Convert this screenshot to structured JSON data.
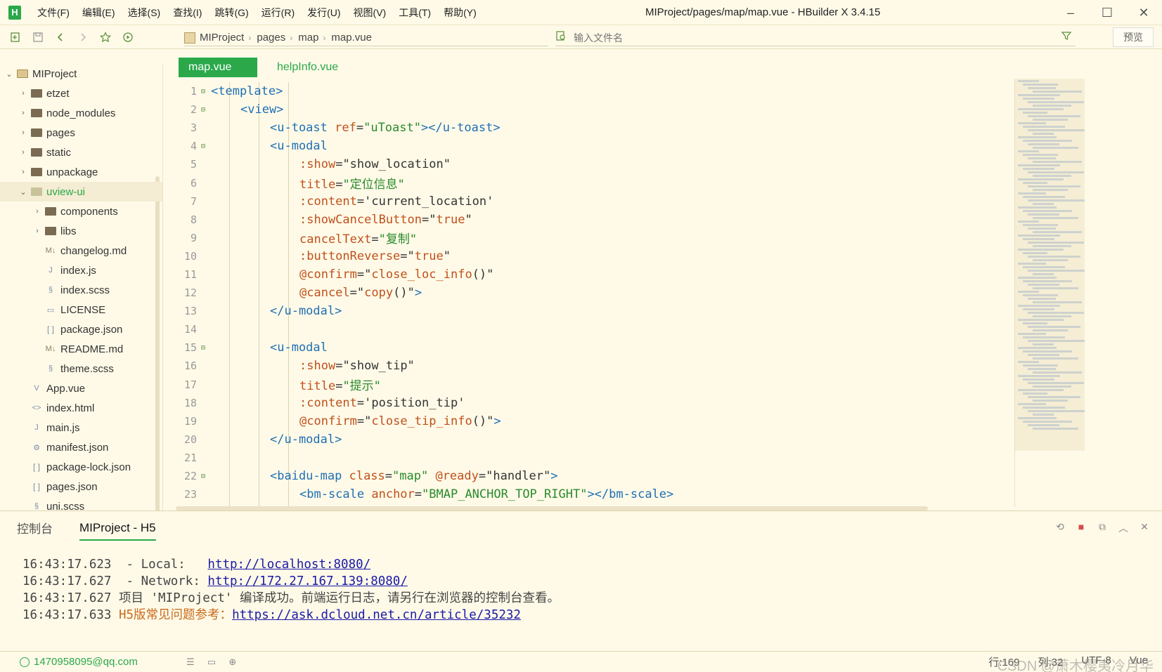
{
  "window": {
    "title": "MIProject/pages/map/map.vue - HBuilder X 3.4.15",
    "logo": "H",
    "controls": [
      "–",
      "☐",
      "✕"
    ]
  },
  "menu": [
    "文件(F)",
    "编辑(E)",
    "选择(S)",
    "查找(I)",
    "跳转(G)",
    "运行(R)",
    "发行(U)",
    "视图(V)",
    "工具(T)",
    "帮助(Y)"
  ],
  "toolbar": {
    "breadcrumb": [
      "MIProject",
      "pages",
      "map",
      "map.vue"
    ],
    "file_search_placeholder": "输入文件名",
    "preview_label": "预览"
  },
  "sidebar": {
    "items": [
      {
        "label": "MIProject",
        "type": "project",
        "depth": 0,
        "expanded": true
      },
      {
        "label": "etzet",
        "type": "folder",
        "depth": 1,
        "expanded": false
      },
      {
        "label": "node_modules",
        "type": "folder",
        "depth": 1,
        "expanded": false
      },
      {
        "label": "pages",
        "type": "folder",
        "depth": 1,
        "expanded": false
      },
      {
        "label": "static",
        "type": "folder",
        "depth": 1,
        "expanded": false
      },
      {
        "label": "unpackage",
        "type": "folder",
        "depth": 1,
        "expanded": false
      },
      {
        "label": "uview-ui",
        "type": "folder-open",
        "depth": 1,
        "expanded": true,
        "selected": true
      },
      {
        "label": "components",
        "type": "folder",
        "depth": 2,
        "expanded": false
      },
      {
        "label": "libs",
        "type": "folder",
        "depth": 2,
        "expanded": false
      },
      {
        "label": "changelog.md",
        "type": "md",
        "depth": 2
      },
      {
        "label": "index.js",
        "type": "js",
        "depth": 2
      },
      {
        "label": "index.scss",
        "type": "scss",
        "depth": 2
      },
      {
        "label": "LICENSE",
        "type": "file",
        "depth": 2
      },
      {
        "label": "package.json",
        "type": "json",
        "depth": 2
      },
      {
        "label": "README.md",
        "type": "md",
        "depth": 2
      },
      {
        "label": "theme.scss",
        "type": "scss",
        "depth": 2
      },
      {
        "label": "App.vue",
        "type": "vue",
        "depth": 1
      },
      {
        "label": "index.html",
        "type": "html",
        "depth": 1
      },
      {
        "label": "main.js",
        "type": "js",
        "depth": 1
      },
      {
        "label": "manifest.json",
        "type": "manifest",
        "depth": 1
      },
      {
        "label": "package-lock.json",
        "type": "json",
        "depth": 1
      },
      {
        "label": "pages.json",
        "type": "json",
        "depth": 1
      },
      {
        "label": "uni.scss",
        "type": "scss",
        "depth": 1
      }
    ]
  },
  "editor": {
    "tabs": [
      {
        "label": "map.vue",
        "active": true
      },
      {
        "label": "helpInfo.vue",
        "active": false
      }
    ],
    "lines": [
      {
        "n": "1",
        "fold": true,
        "indent": 0,
        "parts": [
          [
            "tag",
            "<template>"
          ]
        ]
      },
      {
        "n": "2",
        "fold": true,
        "indent": 1,
        "parts": [
          [
            "tag",
            "<view>"
          ]
        ]
      },
      {
        "n": "3",
        "fold": false,
        "indent": 2,
        "parts": [
          [
            "tag",
            "<u-toast "
          ],
          [
            "attr",
            "ref"
          ],
          [
            "punc",
            "="
          ],
          [
            "val",
            "\"uToast\""
          ],
          [
            "tag",
            "></u-toast>"
          ]
        ]
      },
      {
        "n": "4",
        "fold": true,
        "indent": 2,
        "parts": [
          [
            "tag",
            "<u-modal"
          ]
        ]
      },
      {
        "n": "5",
        "fold": false,
        "indent": 3,
        "parts": [
          [
            "attr",
            ":show"
          ],
          [
            "punc",
            "="
          ],
          [
            "punc",
            "\"show_location\""
          ]
        ]
      },
      {
        "n": "6",
        "fold": false,
        "indent": 3,
        "parts": [
          [
            "attr",
            "title"
          ],
          [
            "punc",
            "="
          ],
          [
            "val",
            "\"定位信息\""
          ]
        ]
      },
      {
        "n": "7",
        "fold": false,
        "indent": 3,
        "parts": [
          [
            "attr",
            ":content"
          ],
          [
            "punc",
            "="
          ],
          [
            "punc",
            "'current_location'"
          ]
        ]
      },
      {
        "n": "8",
        "fold": false,
        "indent": 3,
        "parts": [
          [
            "attr",
            ":showCancelButton"
          ],
          [
            "punc",
            "="
          ],
          [
            "punc",
            "\""
          ],
          [
            "attr",
            "true"
          ],
          [
            "punc",
            "\""
          ]
        ]
      },
      {
        "n": "9",
        "fold": false,
        "indent": 3,
        "parts": [
          [
            "attr",
            "cancelText"
          ],
          [
            "punc",
            "="
          ],
          [
            "val",
            "\"复制\""
          ]
        ]
      },
      {
        "n": "10",
        "fold": false,
        "indent": 3,
        "parts": [
          [
            "attr",
            ":buttonReverse"
          ],
          [
            "punc",
            "="
          ],
          [
            "punc",
            "\""
          ],
          [
            "attr",
            "true"
          ],
          [
            "punc",
            "\""
          ]
        ]
      },
      {
        "n": "11",
        "fold": false,
        "indent": 3,
        "parts": [
          [
            "attr",
            "@confirm"
          ],
          [
            "punc",
            "="
          ],
          [
            "punc",
            "\""
          ],
          [
            "attr",
            "close_loc_info"
          ],
          [
            "punc",
            "()\""
          ]
        ]
      },
      {
        "n": "12",
        "fold": false,
        "indent": 3,
        "parts": [
          [
            "attr",
            "@cancel"
          ],
          [
            "punc",
            "="
          ],
          [
            "punc",
            "\""
          ],
          [
            "attr",
            "copy"
          ],
          [
            "punc",
            "()\""
          ],
          [
            "tag",
            ">"
          ]
        ]
      },
      {
        "n": "13",
        "fold": false,
        "indent": 2,
        "parts": [
          [
            "tag",
            "</u-modal>"
          ]
        ]
      },
      {
        "n": "14",
        "fold": false,
        "indent": 0,
        "parts": []
      },
      {
        "n": "15",
        "fold": true,
        "indent": 2,
        "parts": [
          [
            "tag",
            "<u-modal"
          ]
        ]
      },
      {
        "n": "16",
        "fold": false,
        "indent": 3,
        "parts": [
          [
            "attr",
            ":show"
          ],
          [
            "punc",
            "="
          ],
          [
            "punc",
            "\"show_tip\""
          ]
        ]
      },
      {
        "n": "17",
        "fold": false,
        "indent": 3,
        "parts": [
          [
            "attr",
            "title"
          ],
          [
            "punc",
            "="
          ],
          [
            "val",
            "\"提示\""
          ]
        ]
      },
      {
        "n": "18",
        "fold": false,
        "indent": 3,
        "parts": [
          [
            "attr",
            ":content"
          ],
          [
            "punc",
            "="
          ],
          [
            "punc",
            "'position_tip'"
          ]
        ]
      },
      {
        "n": "19",
        "fold": false,
        "indent": 3,
        "parts": [
          [
            "attr",
            "@confirm"
          ],
          [
            "punc",
            "="
          ],
          [
            "punc",
            "\""
          ],
          [
            "attr",
            "close_tip_info"
          ],
          [
            "punc",
            "()\""
          ],
          [
            "tag",
            ">"
          ]
        ]
      },
      {
        "n": "20",
        "fold": false,
        "indent": 2,
        "parts": [
          [
            "tag",
            "</u-modal>"
          ]
        ]
      },
      {
        "n": "21",
        "fold": false,
        "indent": 0,
        "parts": []
      },
      {
        "n": "22",
        "fold": true,
        "indent": 2,
        "parts": [
          [
            "tag",
            "<baidu-map "
          ],
          [
            "attr",
            "class"
          ],
          [
            "punc",
            "="
          ],
          [
            "val",
            "\"map\" "
          ],
          [
            "attr",
            "@ready"
          ],
          [
            "punc",
            "="
          ],
          [
            "punc",
            "\"handler\""
          ],
          [
            "tag",
            ">"
          ]
        ]
      },
      {
        "n": "23",
        "fold": false,
        "indent": 3,
        "parts": [
          [
            "tag",
            "<bm-scale "
          ],
          [
            "attr",
            "anchor"
          ],
          [
            "punc",
            "="
          ],
          [
            "val",
            "\"BMAP_ANCHOR_TOP_RIGHT\""
          ],
          [
            "tag",
            "></bm-scale>"
          ]
        ]
      }
    ]
  },
  "console": {
    "tabs": [
      "控制台",
      "MIProject - H5"
    ],
    "lines": [
      {
        "time": "16:43:17.623",
        "text": "  - Local:   ",
        "link": "http://localhost:8080/",
        "warn": "",
        "after": ""
      },
      {
        "time": "16:43:17.627",
        "text": "  - Network: ",
        "link": "http://172.27.167.139:8080/",
        "warn": "",
        "after": ""
      },
      {
        "time": "16:43:17.627",
        "text": " 项目 'MIProject' 编译成功。前端运行日志，请另行在浏览器的控制台查看。",
        "link": "",
        "warn": "",
        "after": ""
      },
      {
        "time": "16:43:17.633",
        "text": " ",
        "link": "https://ask.dcloud.net.cn/article/35232",
        "warn": "H5版常见问题参考：",
        "after": ""
      }
    ]
  },
  "statusbar": {
    "user": "1470958095@qq.com",
    "position": "行:169",
    "column": "列:32",
    "encoding": "UTF-8",
    "language": "Vue",
    "watermark": "CSDN @萧木樱夷冷月华"
  },
  "colors": {
    "accent": "#2aa84a",
    "background": "#fffae8",
    "tag": "#1e6fb4",
    "attr": "#c0501a",
    "string": "#2a8a2a",
    "link": "#1a1aa8",
    "warn": "#c86a1c"
  }
}
